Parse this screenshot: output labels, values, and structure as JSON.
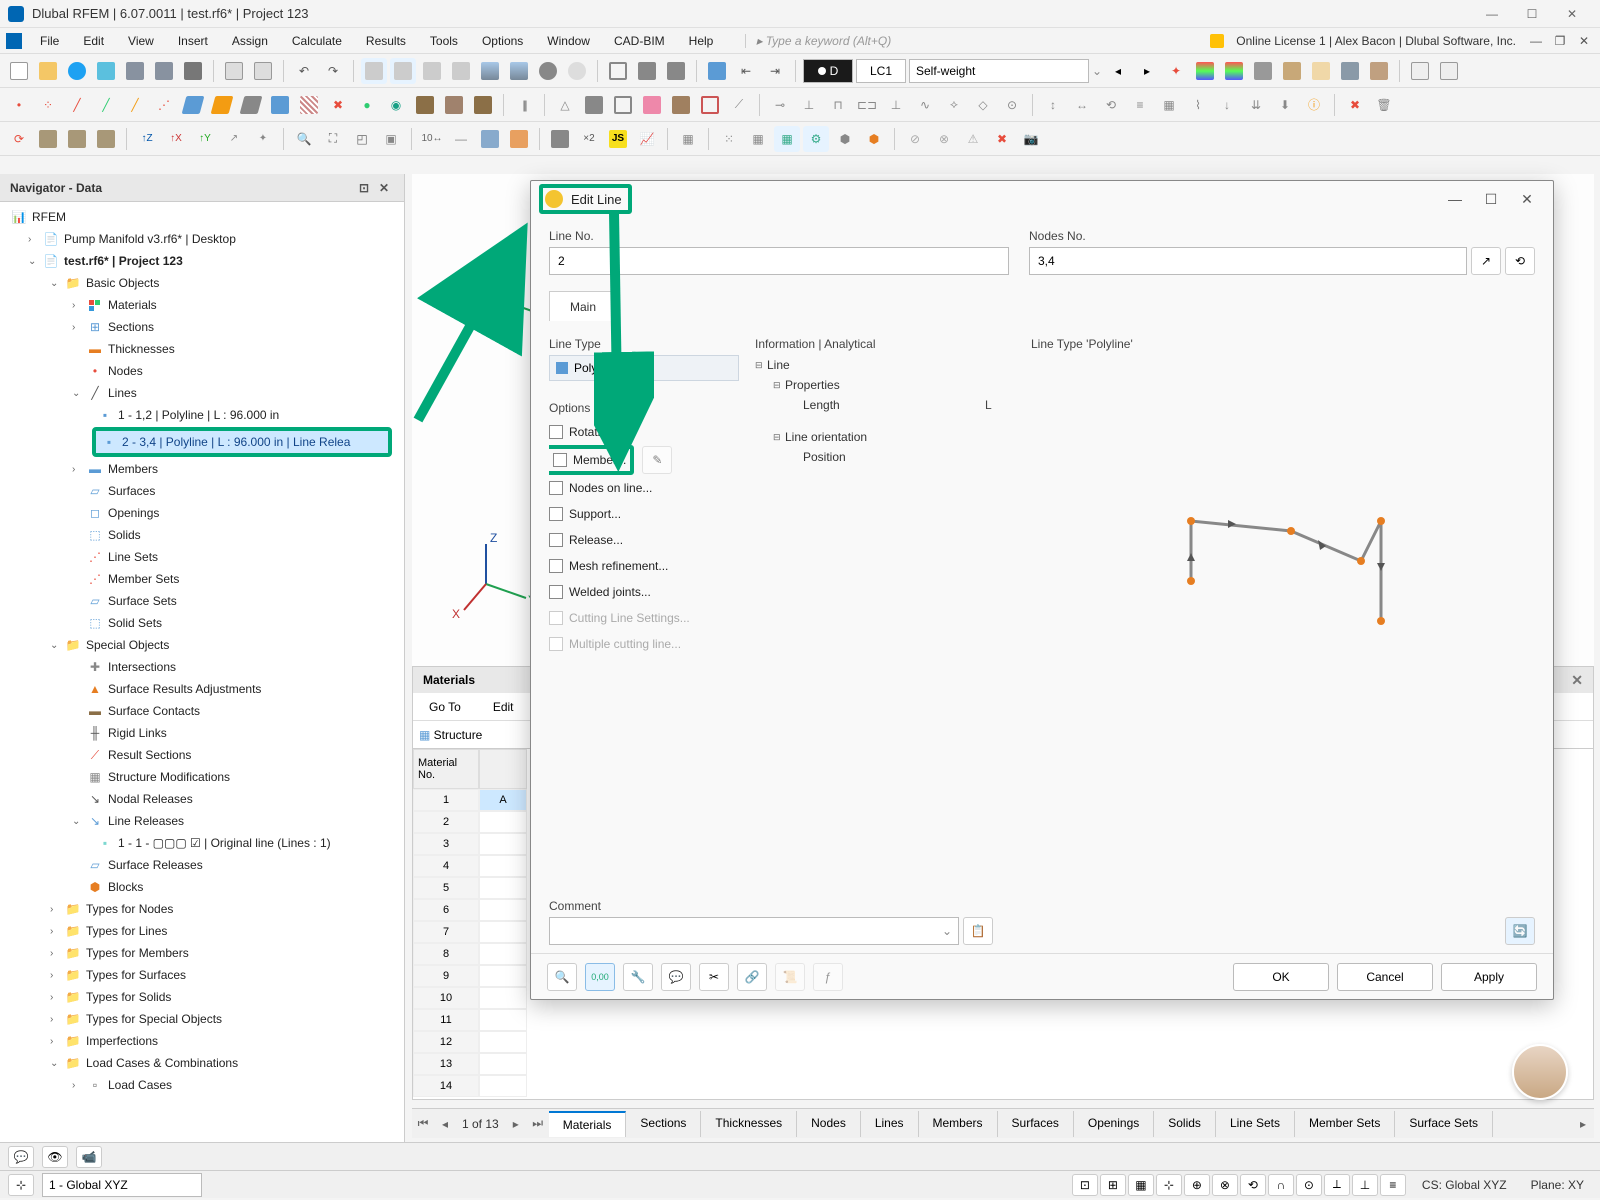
{
  "titlebar": {
    "title": "Dlubal RFEM | 6.07.0011 | test.rf6* | Project 123"
  },
  "menubar": {
    "items": [
      "File",
      "Edit",
      "View",
      "Insert",
      "Assign",
      "Calculate",
      "Results",
      "Tools",
      "Options",
      "Window",
      "CAD-BIM",
      "Help"
    ],
    "keyword_hint": "Type a keyword (Alt+Q)",
    "license": "Online License 1 | Alex Bacon | Dlubal Software, Inc."
  },
  "toolbar": {
    "lc_code": "LC1",
    "lc_name": "Self-weight"
  },
  "navigator": {
    "title": "Navigator - Data",
    "root": "RFEM",
    "model1": "Pump Manifold v3.rf6* | Desktop",
    "model2": "test.rf6* | Project 123",
    "basic": "Basic Objects",
    "items": {
      "materials": "Materials",
      "sections": "Sections",
      "thicknesses": "Thicknesses",
      "nodes": "Nodes",
      "lines": "Lines",
      "line1": "1 - 1,2 | Polyline | L : 96.000 in",
      "line2": "2 - 3,4 | Polyline | L : 96.000 in | Line Relea",
      "members": "Members",
      "surfaces": "Surfaces",
      "openings": "Openings",
      "solids": "Solids",
      "linesets": "Line Sets",
      "membersets": "Member Sets",
      "surfacesets": "Surface Sets",
      "solidsets": "Solid Sets"
    },
    "special": "Special Objects",
    "special_items": {
      "intersections": "Intersections",
      "sra": "Surface Results Adjustments",
      "sc": "Surface Contacts",
      "rl": "Rigid Links",
      "rs": "Result Sections",
      "sm": "Structure Modifications",
      "nr": "Nodal Releases",
      "lrel": "Line Releases",
      "lrel_child": "1 - 1 - ▢▢▢ ☑ | Original line (Lines : 1)",
      "srel": "Surface Releases",
      "blocks": "Blocks"
    },
    "types": {
      "tn": "Types for Nodes",
      "tl": "Types for Lines",
      "tm": "Types for Members",
      "ts": "Types for Surfaces",
      "tso": "Types for Solids",
      "tspo": "Types for Special Objects",
      "imp": "Imperfections",
      "lcc": "Load Cases & Combinations",
      "lc": "Load Cases"
    }
  },
  "materials": {
    "title": "Materials",
    "goto": "Go To",
    "edit": "Edit",
    "structure_tab": "Structure",
    "col1": "Material No.",
    "rows": [
      "1",
      "2",
      "3",
      "4",
      "5",
      "6",
      "7",
      "8",
      "9",
      "10",
      "11",
      "12",
      "13",
      "14"
    ],
    "a_val": "A"
  },
  "bottom_tabs": {
    "counter": "1 of 13",
    "tabs": [
      "Materials",
      "Sections",
      "Thicknesses",
      "Nodes",
      "Lines",
      "Members",
      "Surfaces",
      "Openings",
      "Solids",
      "Line Sets",
      "Member Sets",
      "Surface Sets"
    ]
  },
  "status": {
    "cs": "CS: Global XYZ",
    "plane": "Plane: XY",
    "coord": "1 - Global XYZ"
  },
  "dialog": {
    "title": "Edit Line",
    "line_no_label": "Line No.",
    "line_no": "2",
    "nodes_label": "Nodes No.",
    "nodes": "3,4",
    "tab_main": "Main",
    "sec_linetype": "Line Type",
    "polyline": "Polyline",
    "sec_options": "Options",
    "opts": {
      "rotation": "Rotation...",
      "member": "Member...",
      "nodesonline": "Nodes on line...",
      "support": "Support...",
      "release": "Release...",
      "mesh": "Mesh refinement...",
      "welded": "Welded joints...",
      "cutting": "Cutting Line Settings...",
      "multcut": "Multiple cutting line..."
    },
    "info_header": "Information | Analytical",
    "info": {
      "line": "Line",
      "props": "Properties",
      "length": "Length",
      "length_sym": "L",
      "orient": "Line orientation",
      "position": "Position"
    },
    "preview_title": "Line Type 'Polyline'",
    "comment_label": "Comment",
    "btn_ok": "OK",
    "btn_cancel": "Cancel",
    "btn_apply": "Apply"
  }
}
